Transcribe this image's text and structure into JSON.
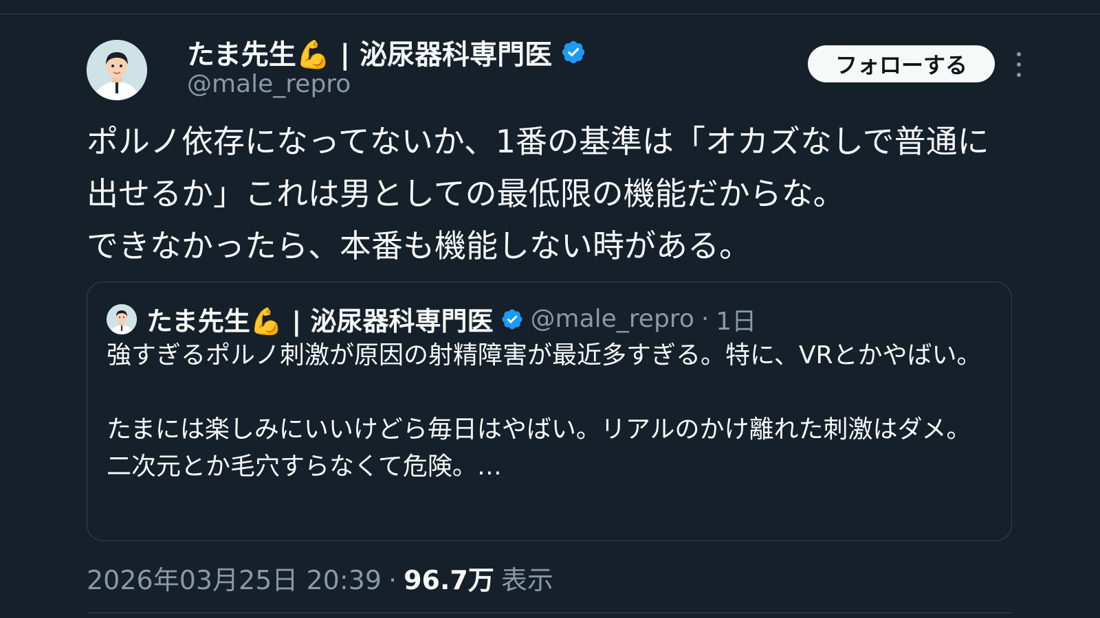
{
  "colors": {
    "background": "#15202b",
    "text_primary": "#f7f9f9",
    "text_secondary": "#8b98a5",
    "verified_blue": "#1d9bf0",
    "border": "#38444d"
  },
  "author": {
    "display_name": "たま先生💪 | 泌尿器科専門医",
    "handle": "@male_repro",
    "avatar_icon": "doctor-avatar",
    "verified_icon": "verified-badge-icon"
  },
  "actions": {
    "follow_label": "フォローする",
    "more_icon": "more-vertical-icon"
  },
  "tweet": {
    "text": "ポルノ依存になってないか、1番の基準は「オカズなしで普通に出せるか」これは男としての最低限の機能だからな。\nできなかったら、本番も機能しない時がある。"
  },
  "quote": {
    "display_name": "たま先生💪 | 泌尿器科専門医",
    "handle": "@male_repro",
    "separator": "·",
    "time": "1日",
    "paragraphs": [
      "強すぎるポルノ刺激が原因の射精障害が最近多すぎる。特に、VRとかやばい。",
      "たまには楽しみにいいけどら毎日はやばい。リアルのかけ離れた刺激はダメ。二次元とか毛穴すらなくて危険。…"
    ]
  },
  "meta": {
    "timestamp": "2026年03月25日 20:39",
    "separator": "·",
    "views_count": "96.7万",
    "views_label": "表示"
  }
}
